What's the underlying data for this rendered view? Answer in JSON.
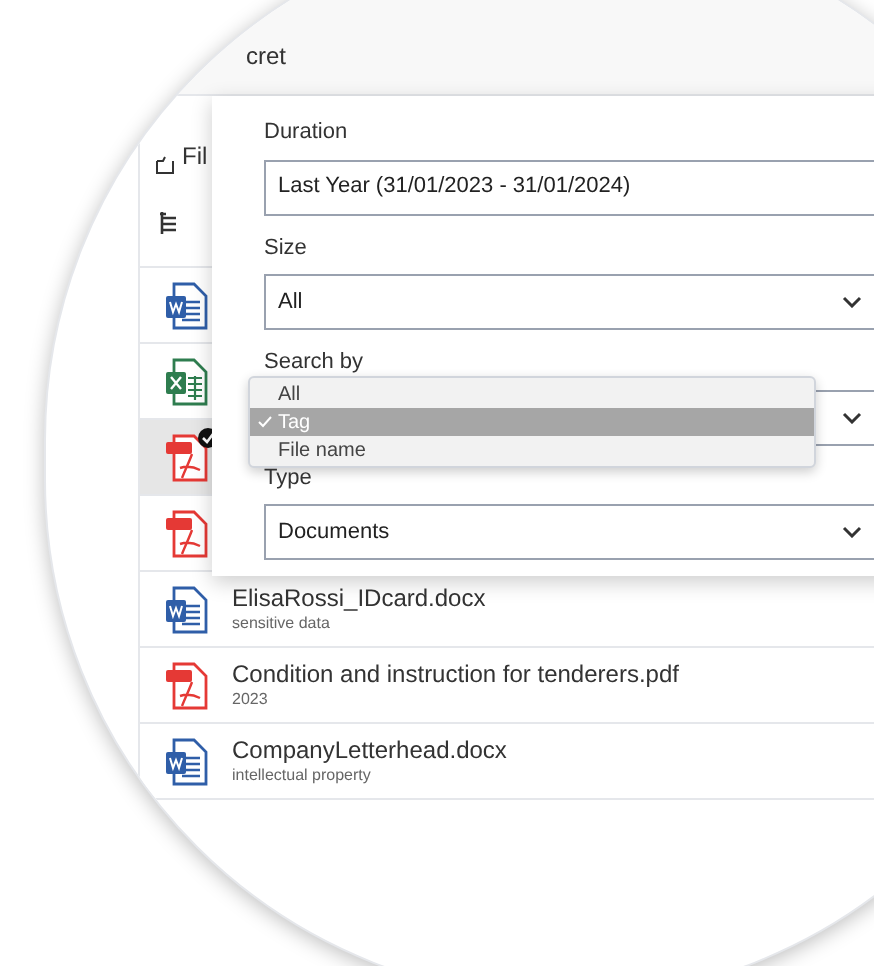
{
  "header": {
    "title": "cret"
  },
  "files_header": {
    "label": "Fil"
  },
  "files": [
    {
      "kind": "word",
      "selected": false,
      "checked": false
    },
    {
      "kind": "excel",
      "selected": false,
      "checked": false
    },
    {
      "kind": "pdf",
      "selected": true,
      "checked": true
    },
    {
      "kind": "pdf",
      "selected": false,
      "checked": false
    },
    {
      "kind": "word",
      "name": "ElisaRossi_IDcard.docx",
      "tag": "sensitive data",
      "selected": false,
      "checked": false
    },
    {
      "kind": "pdf",
      "name": "Condition and instruction for tenderers.pdf",
      "tag": "2023",
      "selected": false,
      "checked": false
    },
    {
      "kind": "word",
      "name": "CompanyLetterhead.docx",
      "tag": "intellectual property",
      "selected": false,
      "checked": false
    }
  ],
  "filters": [
    {
      "kind": "input",
      "label": "Duration",
      "value": "Last Year (31/01/2023 - 31/01/2024)"
    },
    {
      "kind": "select",
      "label": "Size",
      "value": "All"
    },
    {
      "kind": "select",
      "label": "Search by",
      "open": true,
      "options": [
        {
          "label": "All",
          "selected": false
        },
        {
          "label": "Tag",
          "selected": true
        },
        {
          "label": "File name",
          "selected": false
        }
      ]
    },
    {
      "kind": "select",
      "label": "Type",
      "value": "Documents"
    }
  ]
}
